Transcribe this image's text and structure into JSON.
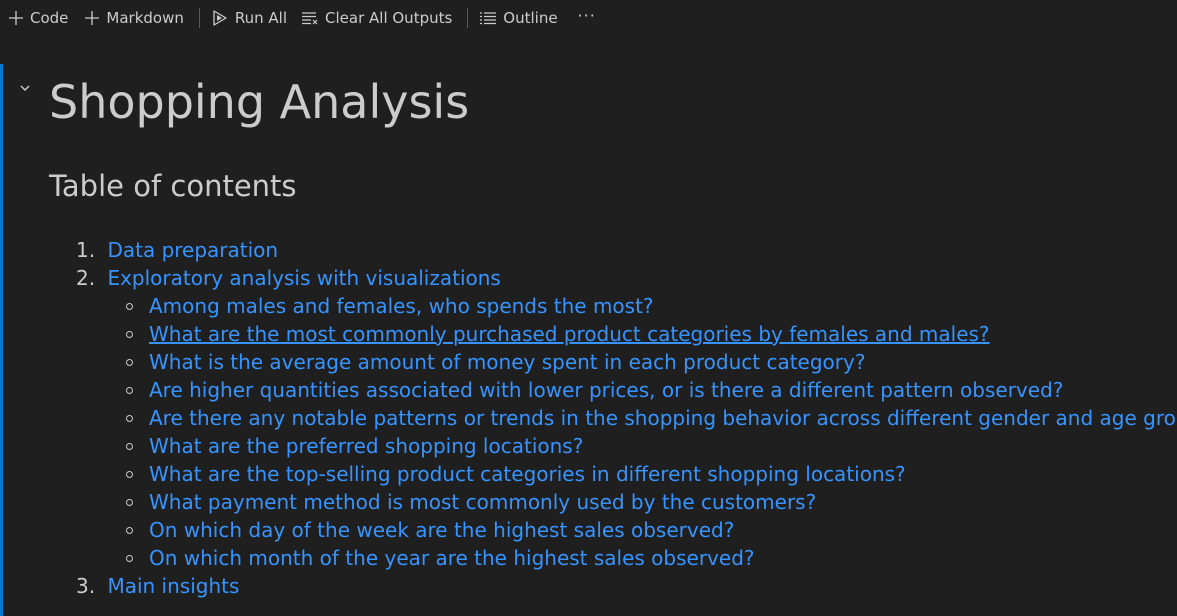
{
  "toolbar": {
    "code_label": "Code",
    "markdown_label": "Markdown",
    "run_all_label": "Run All",
    "clear_outputs_label": "Clear All Outputs",
    "outline_label": "Outline",
    "more_label": "···"
  },
  "cell": {
    "title": "Shopping Analysis",
    "toc_heading": "Table of contents",
    "toc": [
      {
        "num": "1.",
        "label": "Data preparation"
      },
      {
        "num": "2.",
        "label": "Exploratory analysis with visualizations"
      },
      {
        "num": "3.",
        "label": "Main insights"
      }
    ],
    "subitems": [
      "Among males and females, who spends the most?",
      "What are the most commonly purchased product categories by females and males?",
      "What is the average amount of money spent in each product category?",
      "Are higher quantities associated with lower prices, or is there a different pattern observed?",
      "Are there any notable patterns or trends in the shopping behavior across different gender and age groups?",
      "What are the preferred shopping locations?",
      "What are the top-selling product categories in different shopping locations?",
      "What payment method is most commonly used by the customers?",
      "On which day of the week are the highest sales observed?",
      "On which month of the year are the highest sales observed?"
    ]
  },
  "colors": {
    "background": "#1f1f1f",
    "text": "#cccccc",
    "link": "#3794ff",
    "active_cell_bar": "#0078d4"
  }
}
